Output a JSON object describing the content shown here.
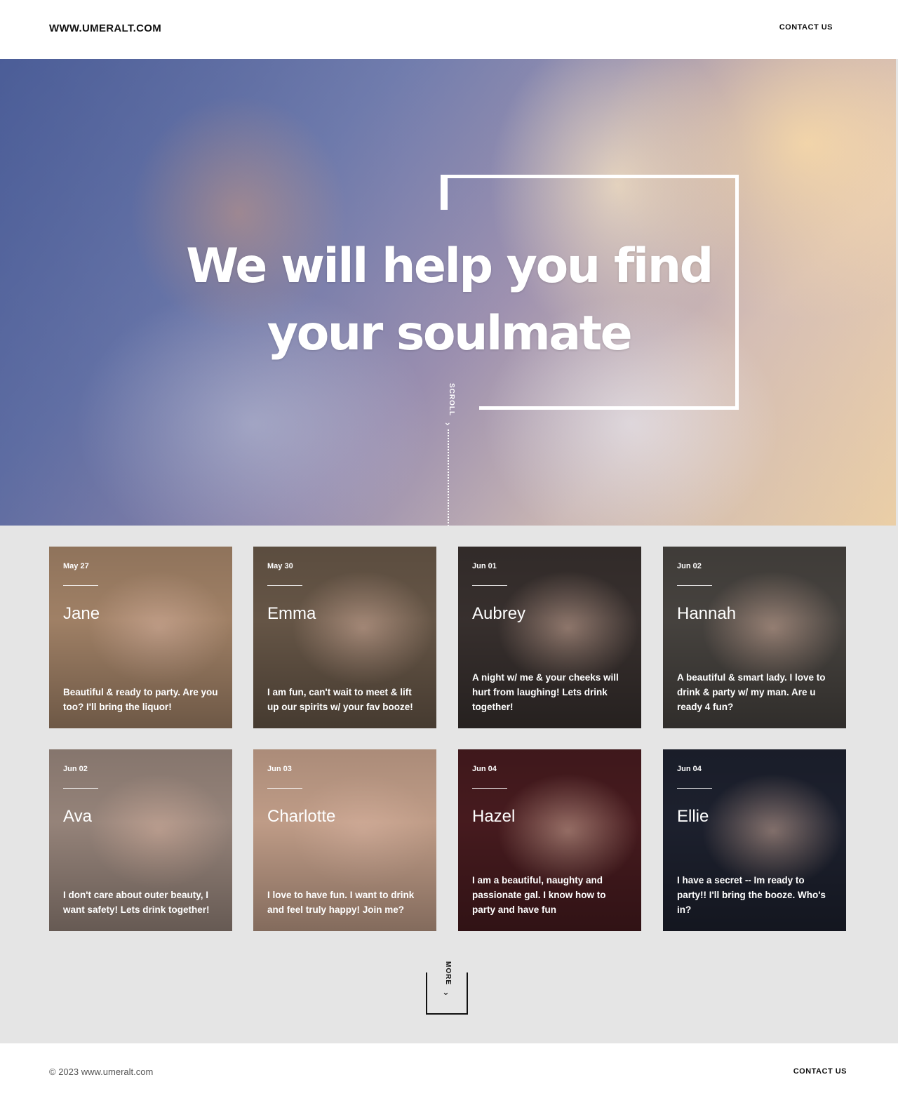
{
  "header": {
    "logo": "WWW.UMERALT.COM",
    "contact_label": "CONTACT US"
  },
  "hero": {
    "title_line1": "We will help you find",
    "title_line2": "your soulmate",
    "scroll_label": "SCROLL"
  },
  "cards": [
    {
      "date": "May 27",
      "name": "Jane",
      "bio": "Beautiful & ready to party. Are you too? I'll bring the liquor!",
      "color": "#a8876b"
    },
    {
      "date": "May 30",
      "name": "Emma",
      "bio": "I am fun, can't wait to meet & lift up our spirits w/ your fav booze!",
      "color": "#6b5a4a"
    },
    {
      "date": "Jun 01",
      "name": "Aubrey",
      "bio": "A night w/ me & your cheeks will hurt from laughing! Lets drink together!",
      "color": "#3a3230"
    },
    {
      "date": "Jun 02",
      "name": "Hannah",
      "bio": "A beautiful & smart lady. I love to drink & party w/ my man. Are u ready 4 fun?",
      "color": "#4a4642"
    },
    {
      "date": "Jun 02",
      "name": "Ava",
      "bio": "I don't care about outer beauty, I want safety! Lets drink together!",
      "color": "#9d8a80"
    },
    {
      "date": "Jun 03",
      "name": "Charlotte",
      "bio": "I love to have fun. I want to drink and feel truly happy! Join me?",
      "color": "#c9a48e"
    },
    {
      "date": "Jun 04",
      "name": "Hazel",
      "bio": "I am a beautiful, naughty and passionate gal. I know how to party and have fun",
      "color": "#4a1c20"
    },
    {
      "date": "Jun 04",
      "name": "Ellie",
      "bio": "I have a secret -- Im ready to party!! I'll bring the booze. Who's in?",
      "color": "#1e2230"
    }
  ],
  "more": {
    "label": "MORE"
  },
  "footer": {
    "copyright": "© 2023 www.umeralt.com",
    "contact_label": "CONTACT US"
  }
}
